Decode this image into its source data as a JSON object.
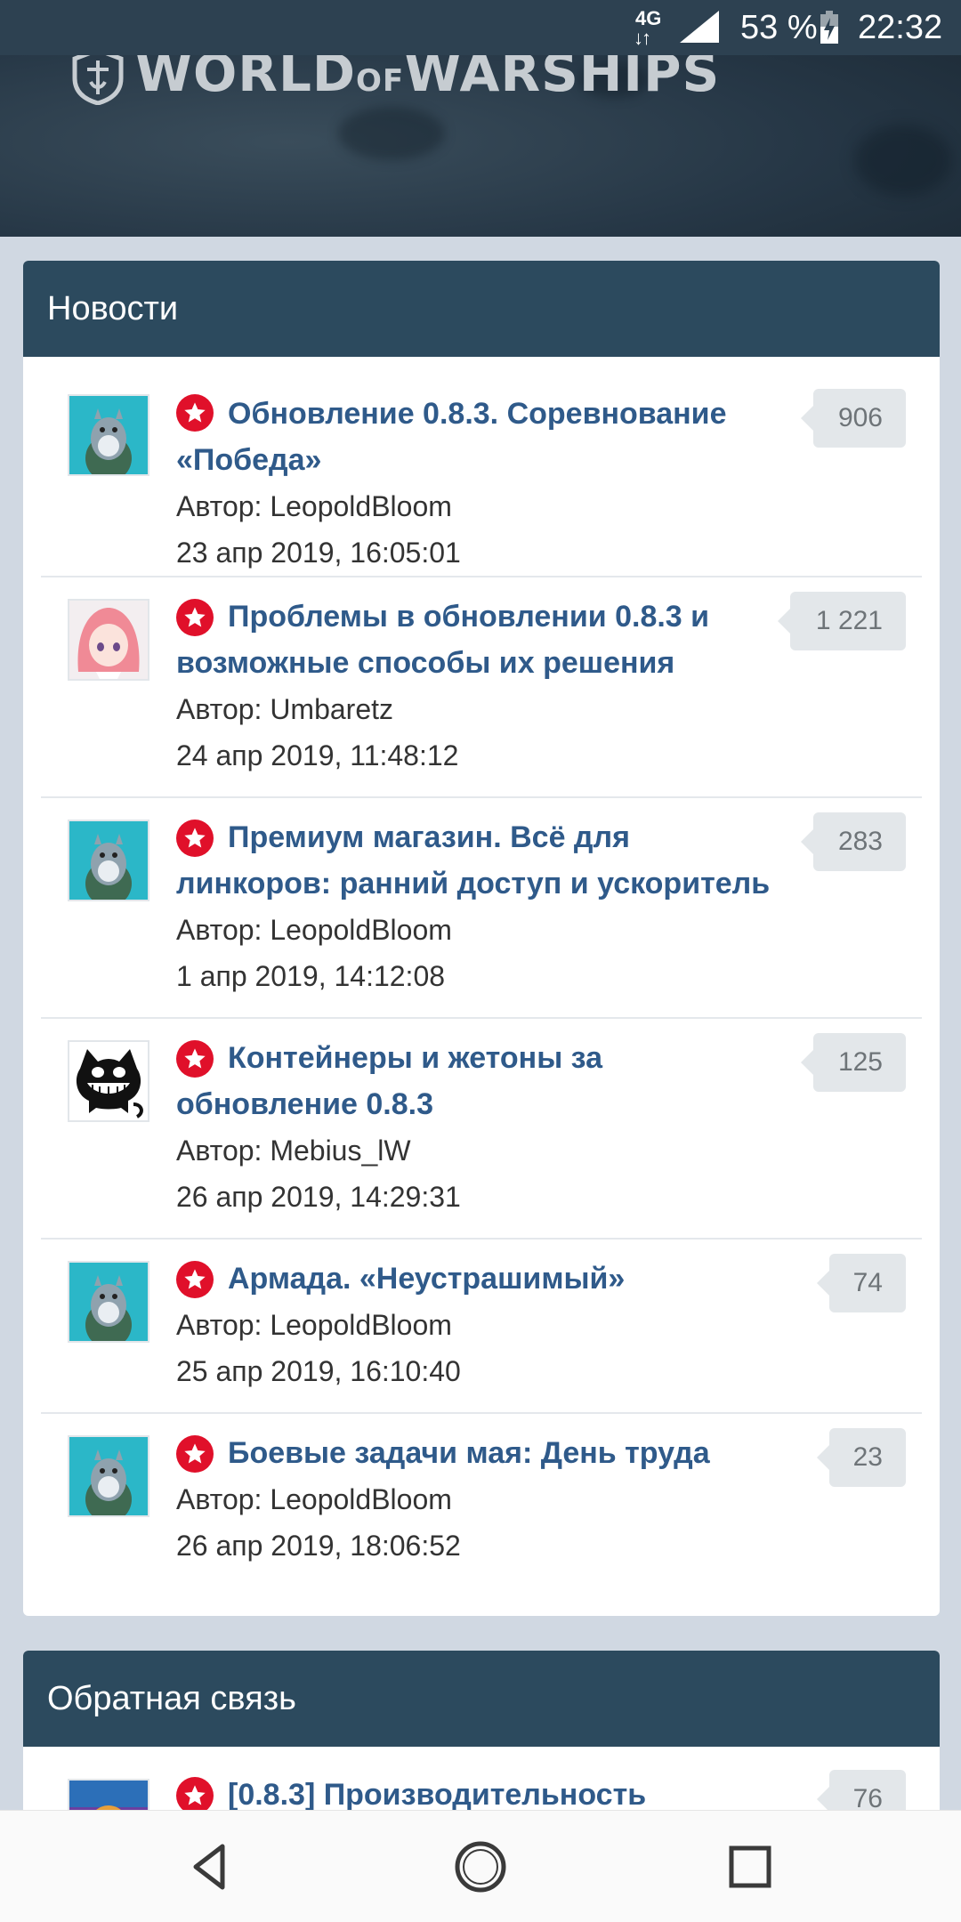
{
  "status_bar": {
    "network": "4G",
    "battery_text": "53 %",
    "time": "22:32"
  },
  "header": {
    "logo_text_1": "WORLD",
    "logo_text_2": "OF",
    "logo_text_3": "WARSHIPS"
  },
  "news": {
    "title": "Новости",
    "items": [
      {
        "title": "Обновление 0.8.3. Соревнование «Победа»",
        "author": "Автор: LeopoldBloom",
        "date": "23 апр 2019, 16:05:01",
        "count": "906",
        "avatar": "totoro-avatar"
      },
      {
        "title": "Проблемы в обновлении 0.8.3 и возможные способы их решения",
        "author": "Автор: Umbaretz",
        "date": "24 апр 2019, 11:48:12",
        "count": "1 221",
        "avatar": "anime-girl-avatar"
      },
      {
        "title": "Премиум магазин. Всё для линкоров: ранний доступ и ускоритель",
        "author": "Автор: LeopoldBloom",
        "date": "1 апр 2019, 14:12:08",
        "count": "283",
        "avatar": "totoro-avatar"
      },
      {
        "title": "Контейнеры и жетоны за обновление 0.8.3",
        "author": "Автор: Mebius_lW",
        "date": "26 апр 2019, 14:29:31",
        "count": "125",
        "avatar": "grinning-cat-avatar"
      },
      {
        "title": "Армада. «Неустрашимый»",
        "author": "Автор: LeopoldBloom",
        "date": "25 апр 2019, 16:10:40",
        "count": "74",
        "avatar": "totoro-avatar"
      },
      {
        "title": "Боевые задачи мая: День труда",
        "author": "Автор: LeopoldBloom",
        "date": "26 апр 2019, 18:06:52",
        "count": "23",
        "avatar": "totoro-avatar"
      }
    ]
  },
  "feedback": {
    "title": "Обратная связь",
    "items": [
      {
        "title": "[0.8.3] Производительность",
        "count": "76",
        "avatar": "colorful-avatar"
      }
    ]
  },
  "colors": {
    "header_bg": "#2c4a5e",
    "link": "#2f5a8a",
    "pin": "#e0102a",
    "page_bg": "#d0d8e2"
  }
}
